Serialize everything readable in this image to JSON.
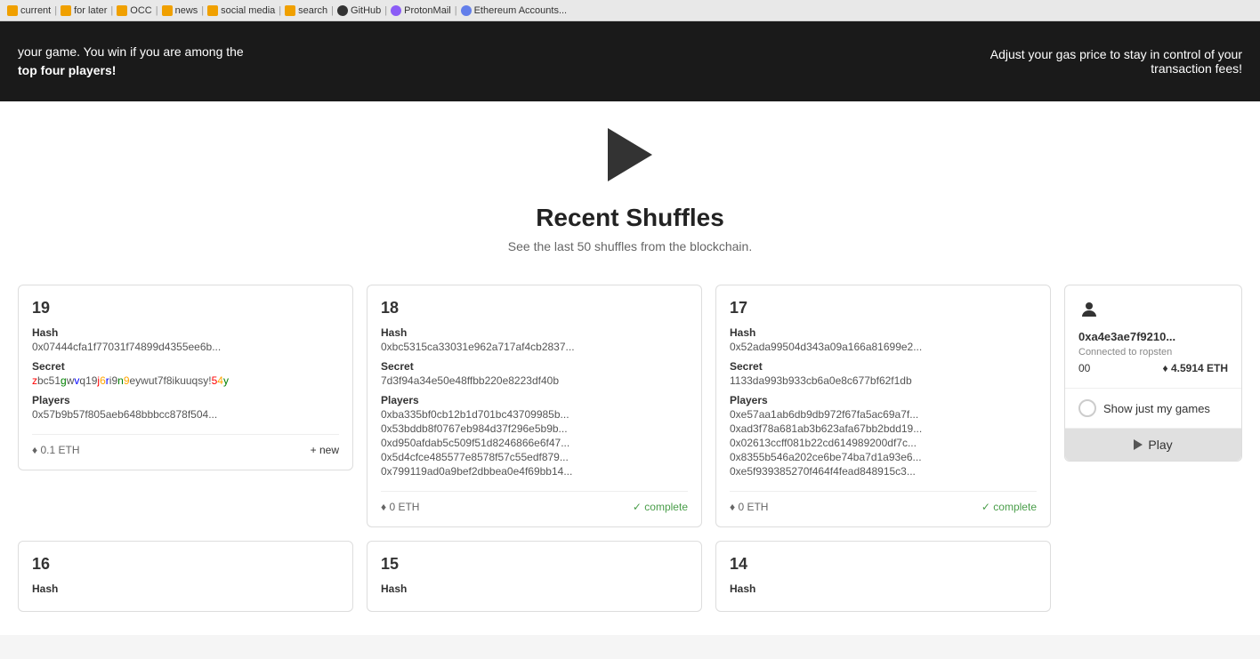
{
  "browser": {
    "tabs": [
      {
        "label": "current",
        "icon": "folder"
      },
      {
        "label": "for later",
        "icon": "folder"
      },
      {
        "label": "OCC",
        "icon": "folder"
      },
      {
        "label": "news",
        "icon": "folder"
      },
      {
        "label": "social media",
        "icon": "folder"
      },
      {
        "label": "search",
        "icon": "folder"
      },
      {
        "label": "GitHub",
        "icon": "github"
      },
      {
        "label": "ProtonMail",
        "icon": "proton"
      },
      {
        "label": "Ethereum Accounts...",
        "icon": "eth"
      }
    ]
  },
  "banner": {
    "left_text": "your game. You win if you are among the",
    "left_bold": "top four players!",
    "right_text": "Adjust your gas price to stay in control of your transaction fees!"
  },
  "hero": {
    "title": "Recent Shuffles",
    "subtitle": "See the last 50 shuffles from the blockchain."
  },
  "cards": [
    {
      "number": "19",
      "hash_label": "Hash",
      "hash": "0x07444cfa1f77031f74899d4355ee6b...",
      "secret_label": "Secret",
      "secret": "zbc51gwvq19j6ri9n9eywut7f8ikuuqsy!54y",
      "secret_colored": true,
      "players_label": "Players",
      "players": [
        "0x57b9b57f805aeb648bbbcc878f504..."
      ],
      "eth": "0.1 ETH",
      "status": "new",
      "status_text": "+ new"
    },
    {
      "number": "18",
      "hash_label": "Hash",
      "hash": "0xbc5315ca33031e962a717af4cb2837...",
      "secret_label": "Secret",
      "secret": "7d3f94a34e50e48ffbb220e8223df40b",
      "secret_colored": false,
      "players_label": "Players",
      "players": [
        "0xba335bf0cb12b1d701bc43709985b...",
        "0x53bddb8f0767eb984d37f296e5b9b...",
        "0xd950afdab5c509f51d8246866e6f47...",
        "0x5d4cfce485577e8578f57c55edf879...",
        "0x799119ad0a9bef2dbbea0e4f69bb14..."
      ],
      "eth": "0 ETH",
      "status": "complete",
      "status_text": "✓ complete"
    },
    {
      "number": "17",
      "hash_label": "Hash",
      "hash": "0x52ada99504d343a09a166a81699e2...",
      "secret_label": "Secret",
      "secret": "1133da993b933cb6a0e8c677bf62f1db",
      "secret_colored": false,
      "players_label": "Players",
      "players": [
        "0xe57aa1ab6db9db972f67fa5ac69a7f...",
        "0xad3f78a681ab3b623afa67bb2bdd19...",
        "0x02613ccff081b22cd614989200df7c...",
        "0x8355b546a202ce6be74ba7d1a93e6...",
        "0xe5f939385270f464f4fead848915c3..."
      ],
      "eth": "0 ETH",
      "status": "complete",
      "status_text": "✓ complete"
    }
  ],
  "sidebar": {
    "user_icon": "👤",
    "address": "0xa4e3ae7f9210...",
    "connected_label": "Connected to ropsten",
    "count": "00",
    "eth_balance": "♦ 4.5914 ETH",
    "toggle_label": "Show just my games",
    "play_label": "Play"
  },
  "row2_cards": [
    {
      "number": "16",
      "hash_label": "Hash"
    },
    {
      "number": "15",
      "hash_label": "Hash"
    },
    {
      "number": "14",
      "hash_label": "Hash"
    }
  ]
}
